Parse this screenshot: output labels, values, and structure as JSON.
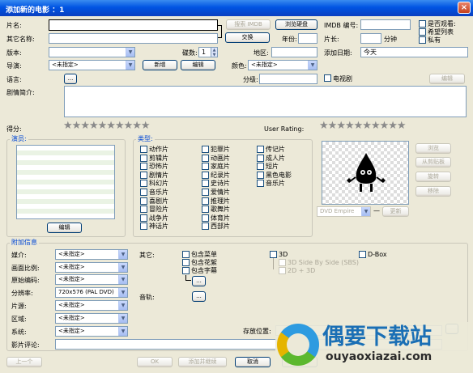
{
  "window": {
    "title": "添加新的电影 ：1",
    "close": "×"
  },
  "labels": {
    "title": "片名:",
    "other_name": "其它名称:",
    "version": "版本:",
    "disc": "碟数:",
    "region": "地区:",
    "director": "导演:",
    "color": "颜色:",
    "language": "语言:",
    "classification": "分级:",
    "plot": "剧情简介:",
    "score": "得分:",
    "user_rating": "User Rating:",
    "imdb_no": "IMDB 编号:",
    "duration": "片长:",
    "minutes": "分钟",
    "year": "年份:",
    "add_date": "添加日期:"
  },
  "fields": {
    "title": "",
    "other_name": "",
    "disc_count": "1",
    "director_select": "<未指定>",
    "color_select": "<未指定>",
    "add_date": "今天"
  },
  "buttons": {
    "search_imdb": "搜索 IMDB",
    "browse_disc": "浏览硬盘",
    "swap": "交换",
    "new": "新增",
    "edit": "编辑",
    "language_more": "...",
    "lang_edit": "编辑",
    "actors_edit": "编辑",
    "browse_img": "浏览",
    "from_clipboard": "从剪贴板",
    "rotate": "旋转",
    "remove": "移除",
    "update": "更新",
    "other_more": "...",
    "audio_more": "...",
    "prev": "上一个",
    "ok": "OK",
    "add_continue": "添加并继续",
    "cancel": "取消",
    "reset": "重置"
  },
  "checks": {
    "seen": "是否观看:",
    "wishlist": "希望列表",
    "private": "私有",
    "tv_series": "电视剧"
  },
  "actors": {
    "title": "演员:"
  },
  "genres": {
    "title": "类型:",
    "col1": [
      "动作片",
      "剪辑片",
      "恐怖片",
      "剧情片",
      "科幻片",
      "音乐片",
      "喜剧片",
      "冒险片",
      "战争片",
      "神话片"
    ],
    "col2": [
      "犯罪片",
      "动画片",
      "家庭片",
      "纪录片",
      "史诗片",
      "爱情片",
      "推理片",
      "歌舞片",
      "体育片",
      "西部片"
    ],
    "col3": [
      "传记片",
      "成人片",
      "短片",
      "黑色电影",
      "音乐片"
    ]
  },
  "poster": {
    "source": "DVD Empire",
    "dash": "—"
  },
  "extra": {
    "title": "附加信息",
    "media": "媒介:",
    "aspect": "画面比例:",
    "encode": "原始编码:",
    "resolution": "分辨率:",
    "studio": "片源:",
    "region": "区域:",
    "system": "系统:",
    "review": "影片评论:",
    "other": "其它:",
    "audio": "音轨:",
    "storage": "存放位置:",
    "resolution_val": "720x576 (PAL DVD)",
    "unspecified": "<未指定>",
    "opts": [
      "包含菜单",
      "包含花絮",
      "包含字幕"
    ],
    "three_d": "3D",
    "three_d_sbs": "3D Side By Side (SBS)",
    "two_d_three_d": "2D + 3D",
    "dbox": "D-Box"
  },
  "watermark": {
    "cn": "偶要下载站",
    "url": "ouyaoxiazai.com"
  },
  "stars_count": 10,
  "colors": {
    "title_blue": "#0054e3",
    "group_text": "#0046d5"
  }
}
